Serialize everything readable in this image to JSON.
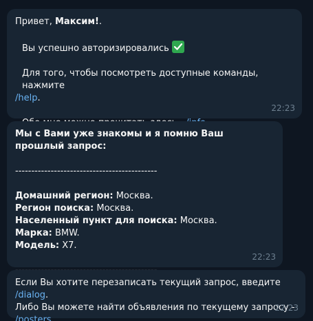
{
  "messages": [
    {
      "greeting_prefix": "Привет, ",
      "greeting_name": "Максим!",
      "greeting_suffix": ".",
      "auth_text": "Вы успешно авторизировались",
      "auth_icon": "check-mark-icon",
      "help_text": "Для того, чтобы посмотреть доступные команды, нажмите",
      "help_link": "/help",
      "help_suffix": ".",
      "info_text": "Обо мне можно прочитать здесь - ",
      "info_link": "/info",
      "info_suffix": ".",
      "time": "22:23"
    },
    {
      "header": "Мы с Вами уже знакомы и я помню Ваш прошлый запрос:",
      "separator": "--------------------------------------------",
      "fields": [
        {
          "label": "Домашний регион:",
          "value": " Москва."
        },
        {
          "label": "Регион поиска:",
          "value": " Москва."
        },
        {
          "label": "Населенный пункт для поиска:",
          "value": " Москва."
        },
        {
          "label": "Марка:",
          "value": " BMW."
        },
        {
          "label": "Модель:",
          "value": " X7."
        }
      ],
      "separator_bottom": "--------------------------------------------",
      "time": "22:23"
    },
    {
      "text_1": "Если Вы хотите перезаписать текущий запрос, введите ",
      "dialog_link": "/dialog",
      "text_1_suffix": ".",
      "text_2": "Либо Вы можете найти объявления по текущему запросу -",
      "posters_link": "/posters",
      "text_2_suffix": ".",
      "time": "22:23"
    }
  ],
  "colors": {
    "background": "#0e1621",
    "bubble": "#182533",
    "link": "#6ab3f3",
    "time": "#6d7f8f"
  }
}
